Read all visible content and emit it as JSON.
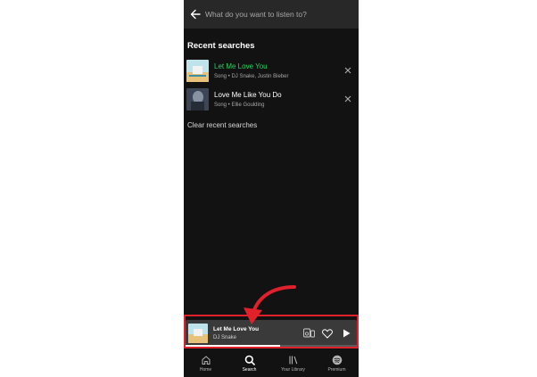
{
  "search": {
    "placeholder": "What do you want to listen to?"
  },
  "recent": {
    "title": "Recent searches",
    "items": [
      {
        "title": "Let Me Love You",
        "meta": "Song • DJ Snake, Justin Bieber",
        "title_color": "#1ed760"
      },
      {
        "title": "Love Me Like You Do",
        "meta": "Song • Ellie Goulding",
        "title_color": "#ffffff"
      }
    ],
    "clear_label": "Clear recent searches"
  },
  "now_playing": {
    "title": "Let Me Love You",
    "artist": "DJ Snake",
    "progress": 0.55
  },
  "nav": {
    "items": [
      {
        "label": "Home",
        "icon": "home-icon"
      },
      {
        "label": "Search",
        "icon": "search-icon",
        "active": true
      },
      {
        "label": "Your Library",
        "icon": "library-icon"
      },
      {
        "label": "Premium",
        "icon": "spotify-icon"
      }
    ]
  },
  "colors": {
    "background": "#121212",
    "accent": "#1ed760",
    "highlight_border": "#e0202a"
  }
}
